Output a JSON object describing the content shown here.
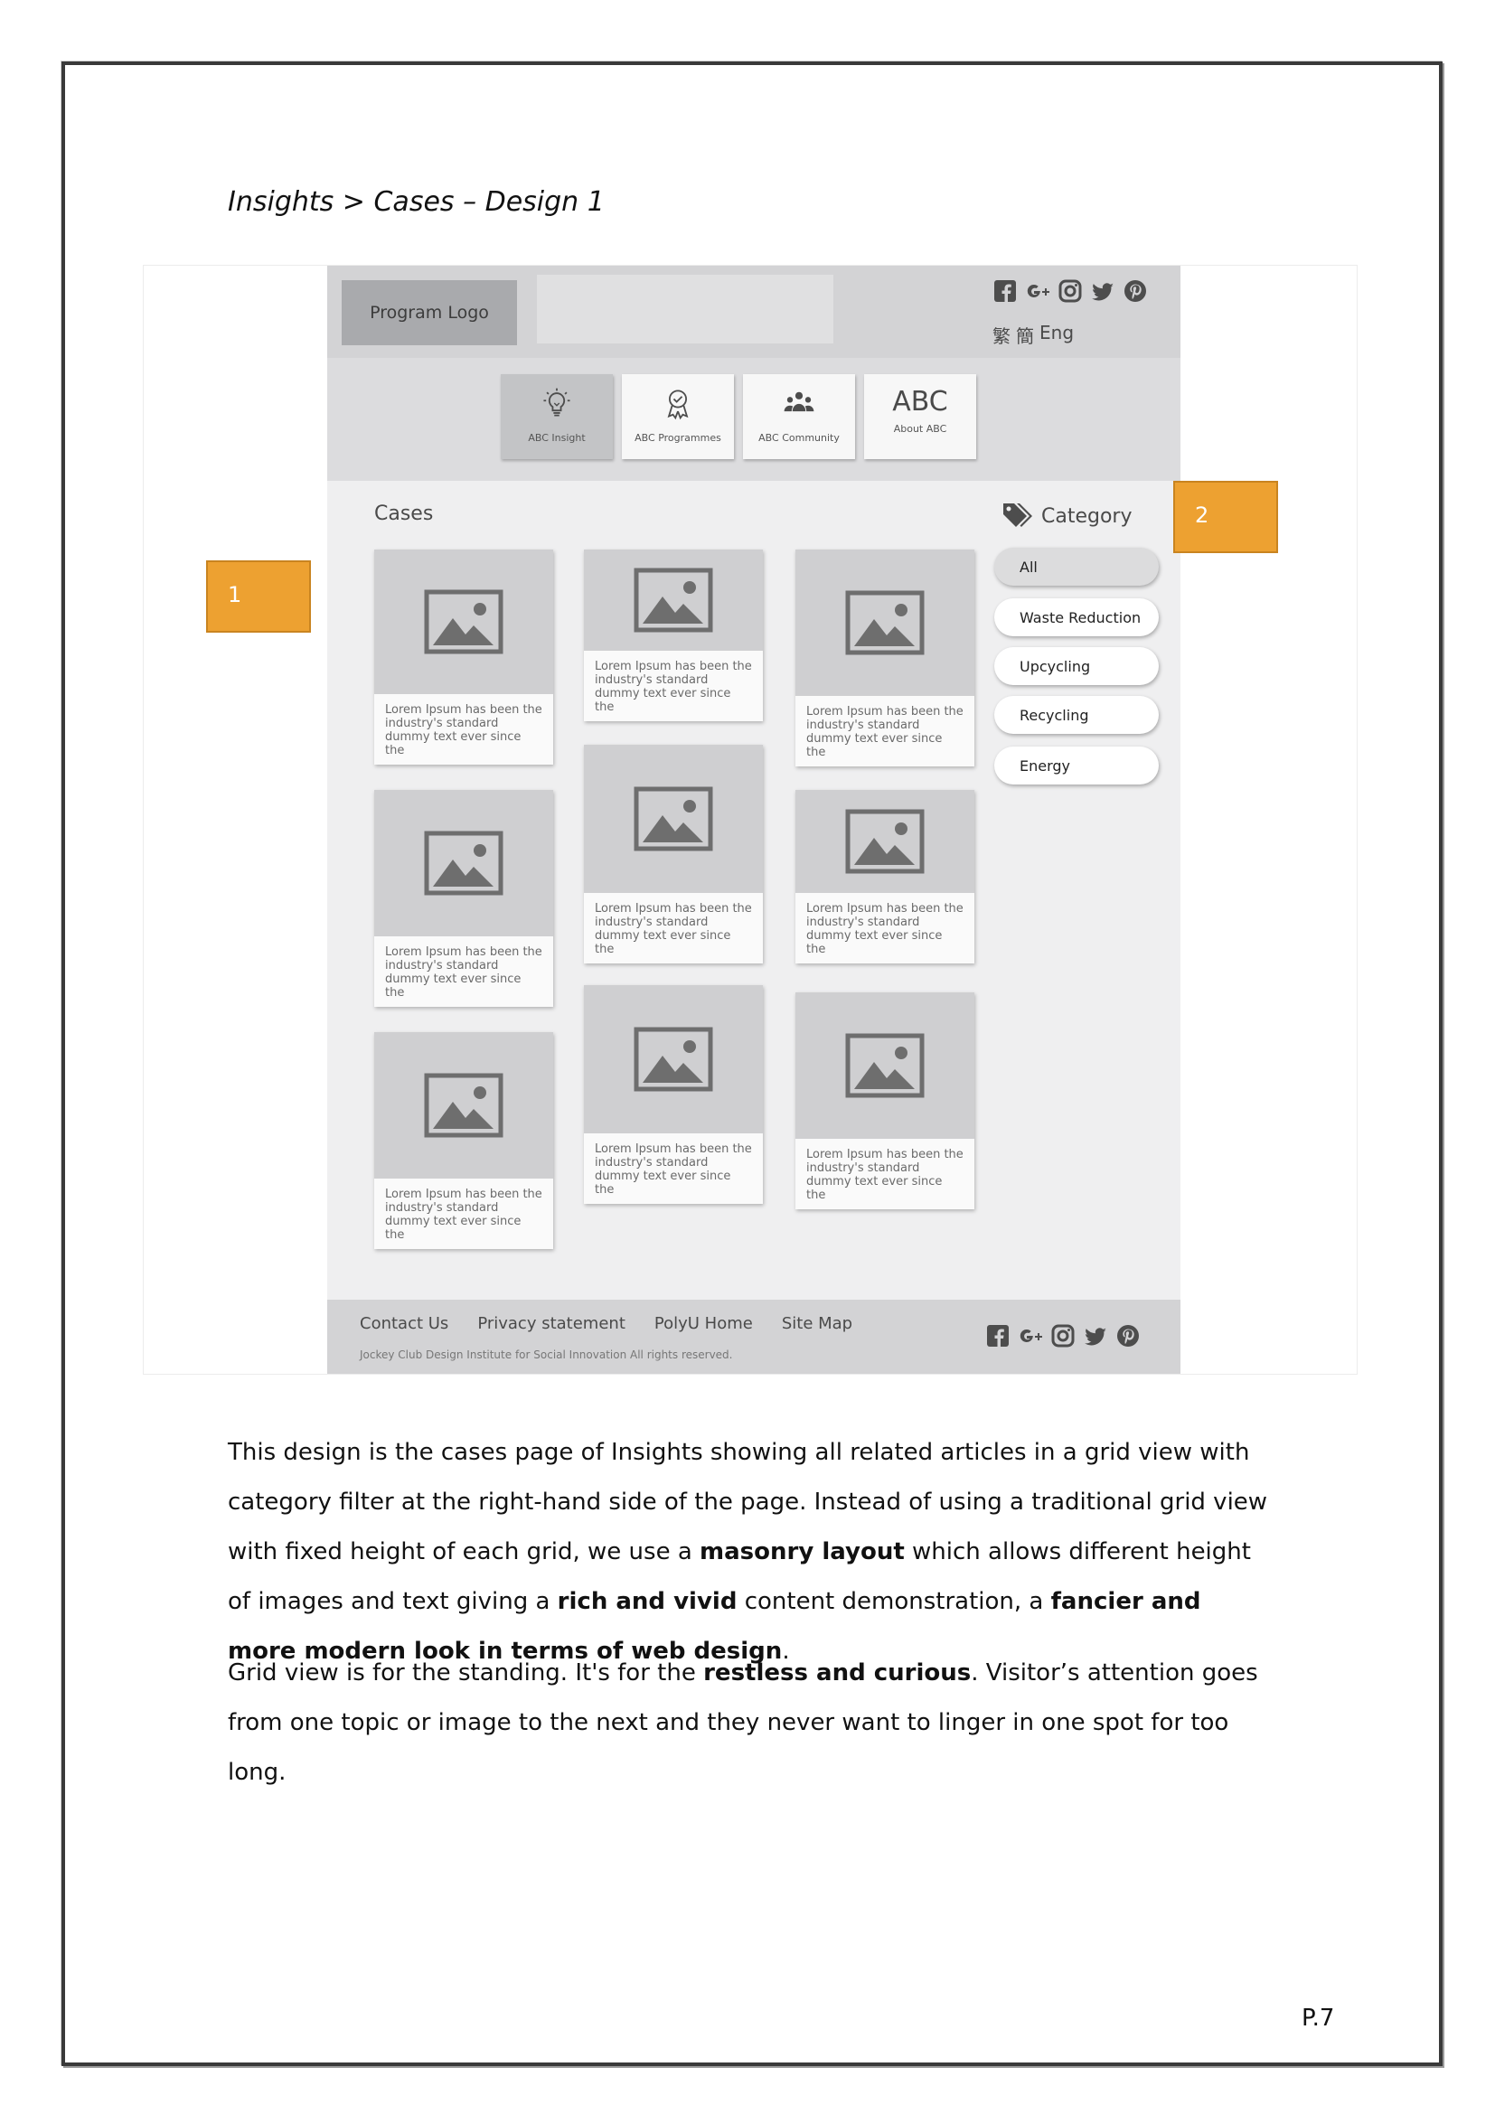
{
  "heading": "Insights > Cases – Design 1",
  "mockup": {
    "logo_text": "Program Logo",
    "lang": [
      "繁",
      "簡",
      "Eng"
    ],
    "nav": [
      {
        "label": "ABC Insight",
        "icon": "lightbulb-icon",
        "active": true
      },
      {
        "label": "ABC Programmes",
        "icon": "award-icon",
        "active": false
      },
      {
        "label": "ABC Community",
        "icon": "community-icon",
        "active": false
      },
      {
        "label": "About ABC",
        "icon": "abc-text",
        "text": "ABC",
        "active": false
      }
    ],
    "cases_title": "Cases",
    "card_text": [
      "Lorem Ipsum has been the industry's standard dummy text ever since the",
      "Lorem Ipsum has been the industry's standard dummy text ever since the",
      "Lorem Ipsum has been the industry's standard dummy text ever since the",
      "Lorem Ipsum has been the industry's standard dummy text ever since the",
      "Lorem Ipsum has been the industry's standard dummy text ever since the",
      "Lorem Ipsum has been the industry's standard dummy text ever since the",
      "Lorem Ipsum has been the industry's standard dummy text ever since the",
      "Lorem Ipsum has been the industry's standard dummy text ever since the",
      "Lorem Ipsum has been the industry's standard dummy text ever since the"
    ],
    "category_title": "Category",
    "categories": [
      "All",
      "Waste Reduction",
      "Upcycling",
      "Recycling",
      "Energy"
    ],
    "selected_category": "All",
    "footer_links": [
      "Contact Us",
      "Privacy statement",
      "PolyU Home",
      "Site Map"
    ],
    "copyright": "Jockey Club Design Institute for Social Innovation All rights reserved.",
    "social_icons": [
      "facebook-icon",
      "google-plus-icon",
      "instagram-icon",
      "twitter-icon",
      "pinterest-icon"
    ]
  },
  "callouts": [
    "1",
    "2"
  ],
  "para1": {
    "t1": "This design is the cases page of Insights showing all related articles in a grid view with category filter at the right-hand side of the page. Instead of using a traditional grid view with fixed height of each grid, we use a ",
    "b1": "masonry layout",
    "t2": " which allows different height of images and text giving a ",
    "b2": "rich and vivid",
    "t3": " content demonstration, a ",
    "b3": "fancier and more modern look in terms of web design",
    "t4": "."
  },
  "para2": {
    "t1": "Grid view is for the standing. It's for the ",
    "b1": "restless and curious",
    "t2": ". Visitor’s attention goes from one topic or image to the next and they never want to linger in one spot for too long."
  },
  "page_number": "P.7"
}
